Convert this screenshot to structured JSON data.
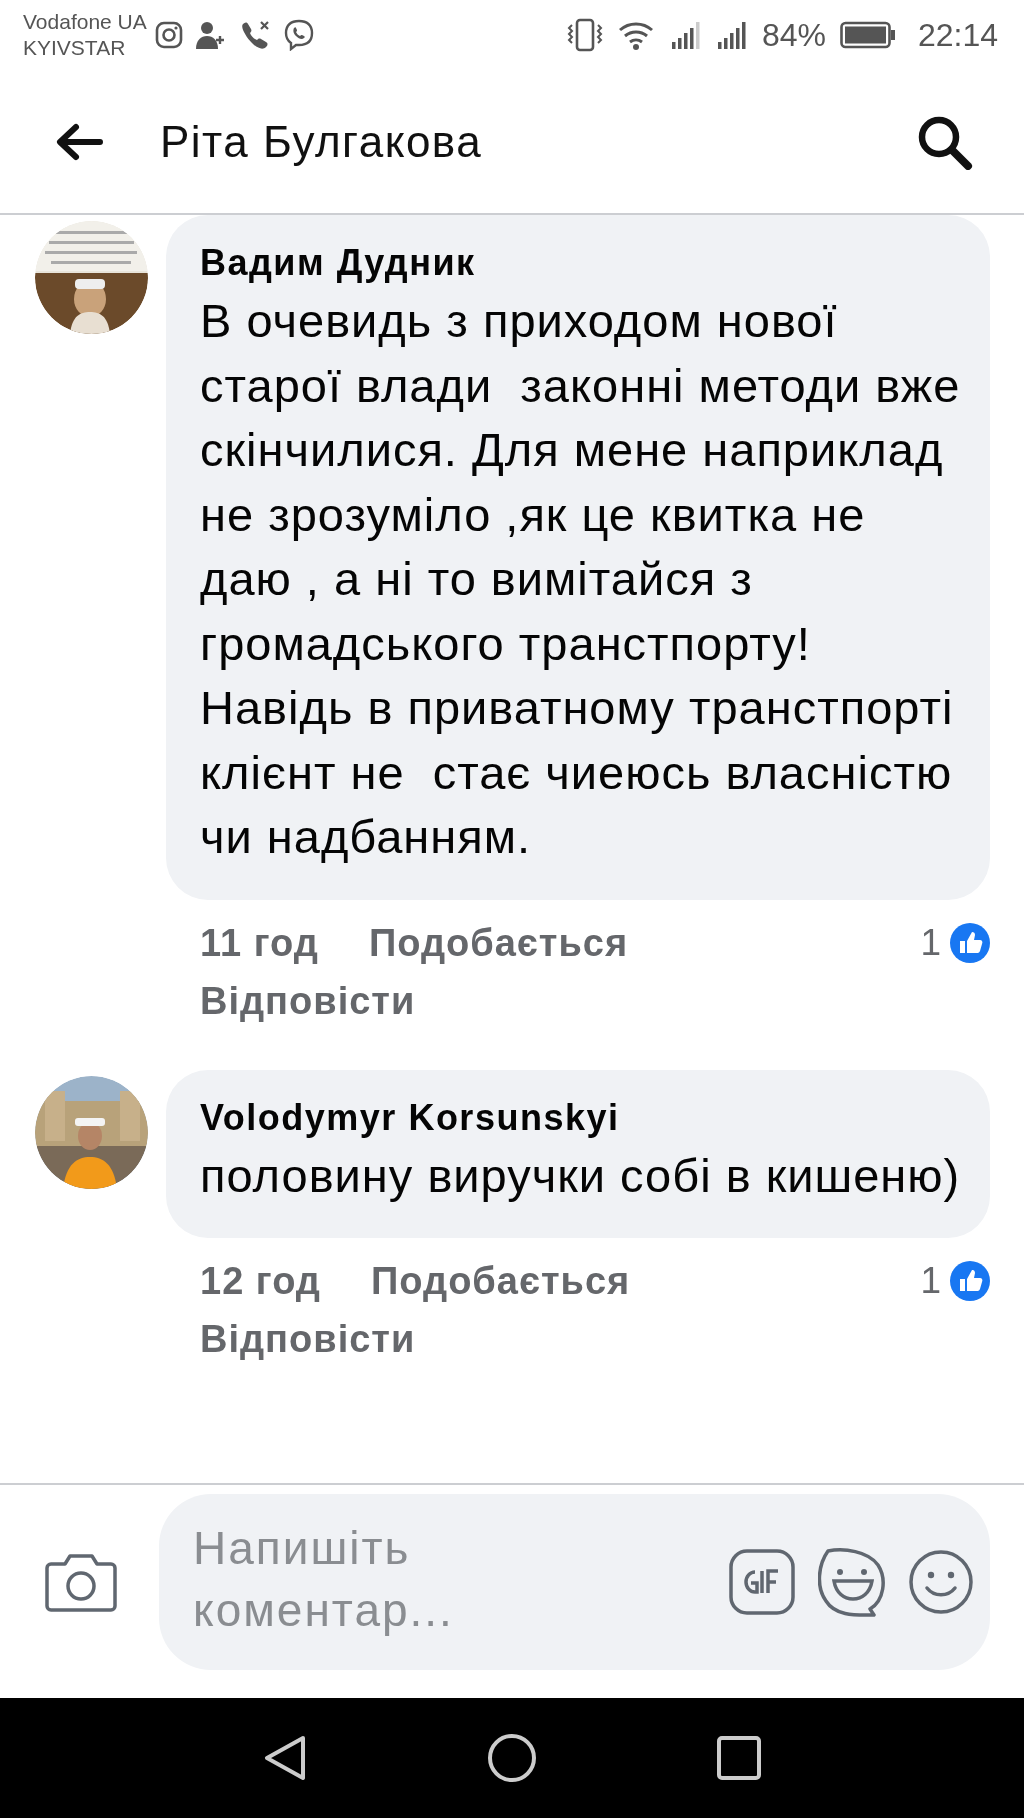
{
  "status_bar": {
    "carriers": [
      "Vodafone UA",
      "KYIVSTAR"
    ],
    "battery": "84%",
    "time": "22:14"
  },
  "header": {
    "title": "Ріта Булгакова"
  },
  "comments": [
    {
      "author": "Вадим Дудник",
      "text": "В очевидь з приходом нової старої влади  законні методи вже скінчилися. Для мене наприклад не зрозуміло ,як це квитка не даю , а ні то вимітайся з громадського транстпорту! Навідь в приватному транстпорті клієнт не  стає чиеюсь власністю чи надбанням.",
      "time": "11 год",
      "like_label": "Подобається",
      "reply_label": "Відповісти",
      "reactions": "1"
    },
    {
      "author": "Volodymyr Korsunskyi",
      "text": "половину виручки собі в кишеню)",
      "time": "12 год",
      "like_label": "Подобається",
      "reply_label": "Відповісти",
      "reactions": "1"
    }
  ],
  "composer": {
    "placeholder": "Напишіть коментар..."
  }
}
